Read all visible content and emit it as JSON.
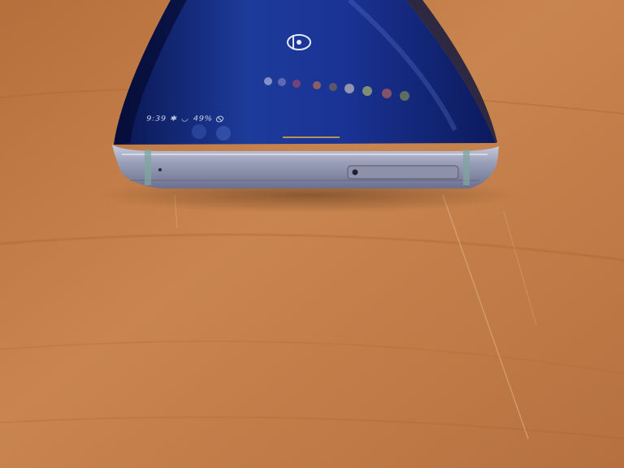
{
  "status_bar": {
    "time": "9:39",
    "battery_percent": "49%",
    "icons": [
      "bluetooth-icon",
      "wifi-icon",
      "battery-icon",
      "do-not-disturb-icon"
    ]
  },
  "colors": {
    "wood": "#c8824a",
    "screen": "#13287a",
    "frame": "#9aa0b8"
  }
}
